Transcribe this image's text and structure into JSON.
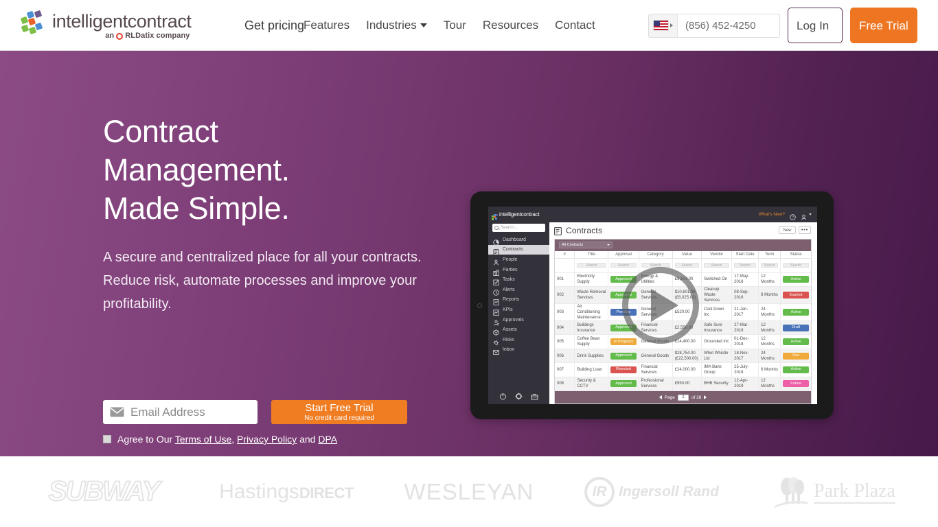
{
  "header": {
    "logo": {
      "word": "intelligentcontract",
      "tagline_pre": "an",
      "tagline_brand": "RLDatix",
      "tagline_post": "company"
    },
    "nav": [
      {
        "label": "Get pricing",
        "two_line": true,
        "caret": false
      },
      {
        "label": "Features",
        "two_line": false,
        "caret": false
      },
      {
        "label": "Industries",
        "two_line": false,
        "caret": true
      },
      {
        "label": "Tour",
        "two_line": false,
        "caret": false
      },
      {
        "label": "Resources",
        "two_line": false,
        "caret": false
      },
      {
        "label": "Contact",
        "two_line": false,
        "caret": false
      }
    ],
    "phone": "(856) 452-4250",
    "login_label": "Log In",
    "trial_label": "Free Trial"
  },
  "hero": {
    "headline_line1": "Contract",
    "headline_line2": "Management.",
    "headline_line3": "Made Simple.",
    "subtext": "A secure and centralized place for all your contracts. Reduce risk, automate processes and improve your profitability.",
    "email_placeholder": "Email Address",
    "cta_main": "Start Free Trial",
    "cta_sub": "No credit card required",
    "agree_prefix": "Agree to Our",
    "agree_link1": "Terms of Use",
    "agree_sep1": ",",
    "agree_link2": "Privacy Policy",
    "agree_sep2": "and",
    "agree_link3": "DPA",
    "accent_orange": "#f07d22",
    "purple_light": "#8c4b85",
    "purple_dark": "#46194a"
  },
  "app": {
    "brand": "intelligentcontract",
    "search_placeholder": "Search....",
    "sidebar": [
      {
        "label": "Dashboard",
        "icon": "dashboard-icon",
        "active": false
      },
      {
        "label": "Contracts",
        "icon": "contracts-icon",
        "active": true
      },
      {
        "label": "People",
        "icon": "people-icon",
        "active": false
      },
      {
        "label": "Parties",
        "icon": "parties-icon",
        "active": false
      },
      {
        "label": "Tasks",
        "icon": "tasks-icon",
        "active": false
      },
      {
        "label": "Alerts",
        "icon": "clock-icon",
        "active": false
      },
      {
        "label": "Reports",
        "icon": "reports-icon",
        "active": false
      },
      {
        "label": "KPIs",
        "icon": "chart-icon",
        "active": false
      },
      {
        "label": "Approvals",
        "icon": "approvals-icon",
        "active": false
      },
      {
        "label": "Assets",
        "icon": "assets-icon",
        "active": false
      },
      {
        "label": "Risks",
        "icon": "risks-icon",
        "active": false
      },
      {
        "label": "Inbox",
        "icon": "inbox-icon",
        "active": false
      }
    ],
    "sidebar_footer_icons": [
      "power-icon",
      "gear-icon",
      "briefcase-icon"
    ],
    "topbar": {
      "whats_new": "What's New?",
      "help_icon": "help-icon",
      "user_icon": "user-icon"
    },
    "page_title": "Contracts",
    "btn_new": "New",
    "btn_more": "•••",
    "filter_label": "All Contracts",
    "columns": [
      "#",
      "Title",
      "Approval",
      "Category",
      "Value",
      "Vendor",
      "Start Date",
      "Term",
      "Status"
    ],
    "search_label": "Search",
    "rows": [
      {
        "num": "001",
        "title": "Electricity Supply",
        "approval": "Approved",
        "approval_color": "#63bb4b",
        "category": "Energy & Utilities",
        "value": "£9,104.00",
        "vendor": "Switched On",
        "start": "17-May-2018",
        "term": "12 Months",
        "status": "Active",
        "status_color": "#63bb4b"
      },
      {
        "num": "002",
        "title": "Waste Removal Services",
        "approval": "Approved",
        "approval_color": "#63bb4b",
        "category": "General Services",
        "value": "$10,601.06 (£8,025.00)",
        "vendor": "Cleanup Waste Services",
        "start": "08-Sep-2016",
        "term": "8 Months",
        "status": "Expired",
        "status_color": "#d9534f"
      },
      {
        "num": "003",
        "title": "Air Conditioning Maintenance",
        "approval": "Pending",
        "approval_color": "#4a72b8",
        "category": "General Services",
        "value": "£520.00",
        "vendor": "Cool Down Inc",
        "start": "21-Jan-2017",
        "term": "24 Months",
        "status": "Active",
        "status_color": "#63bb4b"
      },
      {
        "num": "004",
        "title": "Buildings Insurance",
        "approval": "Approved",
        "approval_color": "#63bb4b",
        "category": "Financial Services",
        "value": "£2,550.00",
        "vendor": "Safe Sure Insurance",
        "start": "27-Mar-2018",
        "term": "12 Months",
        "status": "Draft",
        "status_color": "#4a72b8"
      },
      {
        "num": "005",
        "title": "Coffee Bean Supply",
        "approval": "In Progress",
        "approval_color": "#eda järjest",
        "category": "General Goods",
        "value": "£14,400.00",
        "vendor": "Grounded Inc",
        "start": "01-Dec-2018",
        "term": "12 Months",
        "status": "Active",
        "status_color": "#63bb4b"
      },
      {
        "num": "006",
        "title": "Drink Supplies",
        "approval": "Approved",
        "approval_color": "#63bb4b",
        "category": "General Goods",
        "value": "$28,754.00 (£22,500.00)",
        "vendor": "Whet Whistle Ltd",
        "start": "18-Nov-2017",
        "term": "24 Months",
        "status": "Due",
        "status_color": "#eeaa3c"
      },
      {
        "num": "007",
        "title": "Building Loan",
        "approval": "Rejected",
        "approval_color": "#d9534f",
        "category": "Financial Services",
        "value": "£24,000.00",
        "vendor": "IMA Bank Group",
        "start": "25-July-2018",
        "term": "6 Months",
        "status": "Active",
        "status_color": "#63bb4b"
      },
      {
        "num": "008",
        "title": "Security & CCTV",
        "approval": "Approved",
        "approval_color": "#63bb4b",
        "category": "Professional Services",
        "value": "£950.00",
        "vendor": "BHB Security",
        "start": "12-Apr-2019",
        "term": "12 Months",
        "status": "Future",
        "status_color": "#ee5fa7"
      }
    ],
    "pagination": {
      "prev": "◄",
      "label": "Page",
      "current": "2",
      "of_label": "of 28",
      "next": "►"
    }
  },
  "clients": [
    {
      "name": "SUBWAY",
      "kind": "subway"
    },
    {
      "name": "Hastings DIRECT",
      "kind": "hastings",
      "part1": "Hastings",
      "part2": "DIRECT"
    },
    {
      "name": "WESLEYAN",
      "kind": "wesleyan"
    },
    {
      "name": "Ingersoll Rand",
      "kind": "ingersoll",
      "mark": "IR",
      "word": "Ingersoll Rand"
    },
    {
      "name": "Park Plaza",
      "kind": "parkplaza",
      "word": "Park Plaza"
    }
  ]
}
